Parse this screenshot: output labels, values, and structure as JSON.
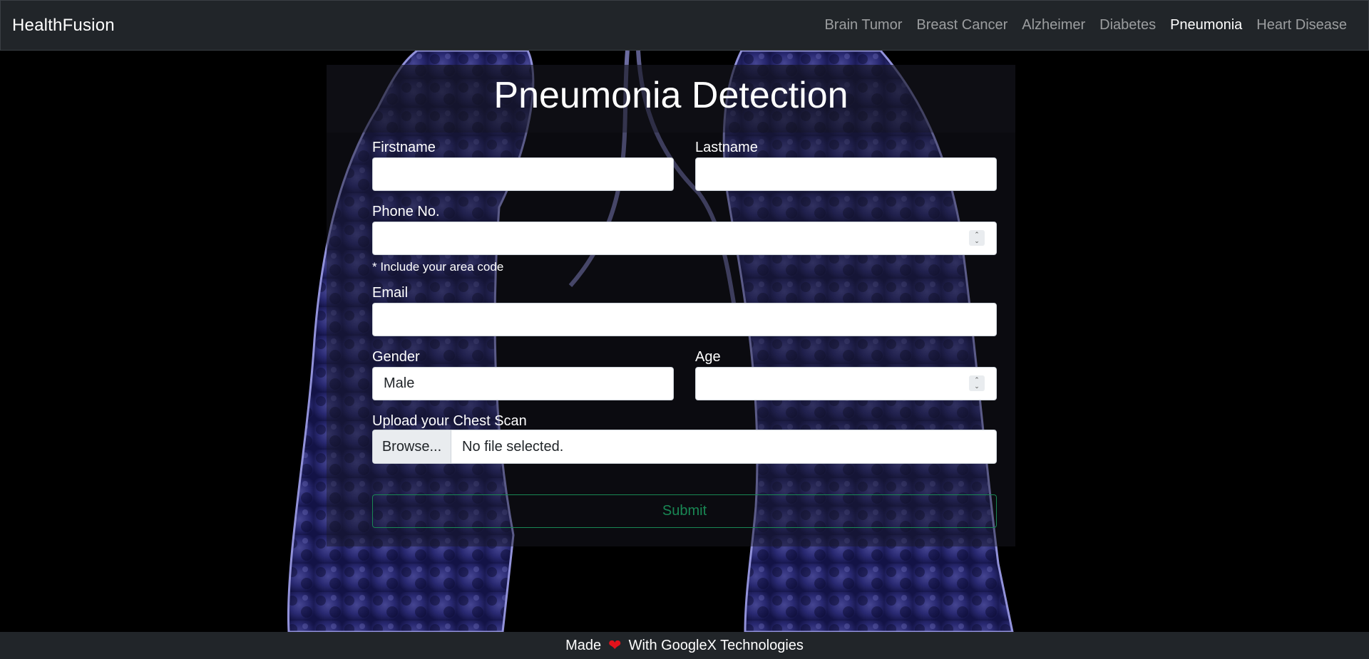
{
  "navbar": {
    "brand": "HealthFusion",
    "links": [
      {
        "label": "Brain Tumor",
        "active": false
      },
      {
        "label": "Breast Cancer",
        "active": false
      },
      {
        "label": "Alzheimer",
        "active": false
      },
      {
        "label": "Diabetes",
        "active": false
      },
      {
        "label": "Pneumonia",
        "active": true
      },
      {
        "label": "Heart Disease",
        "active": false
      }
    ]
  },
  "form": {
    "title": "Pneumonia Detection",
    "firstname_label": "Firstname",
    "firstname_value": "",
    "lastname_label": "Lastname",
    "lastname_value": "",
    "phone_label": "Phone No.",
    "phone_value": "",
    "phone_help": "* Include your area code",
    "email_label": "Email",
    "email_value": "",
    "gender_label": "Gender",
    "gender_value": "Male",
    "age_label": "Age",
    "age_value": "",
    "upload_label": "Upload your Chest Scan",
    "browse_label": "Browse...",
    "file_status": "No file selected.",
    "submit_label": "Submit"
  },
  "footer": {
    "made_text": "Made",
    "heart_icon": "heart-icon",
    "with_text": "With GoogleX Technologies"
  },
  "colors": {
    "navbar_bg": "#212529",
    "submit_accent": "#198754",
    "heart": "#e3121b"
  }
}
